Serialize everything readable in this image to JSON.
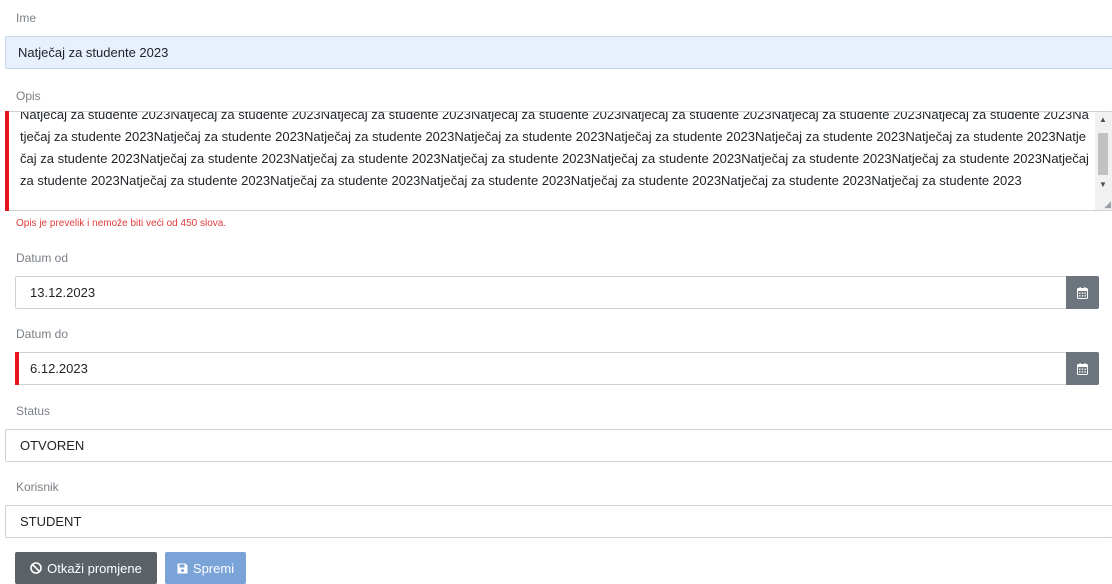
{
  "form": {
    "name": {
      "label": "Ime",
      "value": "Natječaj za studente 2023"
    },
    "description": {
      "label": "Opis",
      "value": "Natječaj za studente 2023Natječaj za studente 2023Natječaj za studente 2023Natječaj za studente 2023Natječaj za studente 2023Natječaj za studente 2023Natječaj za studente 2023Natječaj za studente 2023Natječaj za studente 2023Natječaj za studente 2023Natječaj za studente 2023Natječaj za studente 2023Natječaj za studente 2023Natječaj za studente 2023Natječaj za studente 2023Natječaj za studente 2023Natječaj za studente 2023Natječaj za studente 2023Natječaj za studente 2023Natječaj za studente 2023Natječaj za studente 2023Natječaj za studente 2023Natječaj za studente 2023Natječaj za studente 2023Natječaj za studente 2023Natječaj za studente 2023Natječaj za studente 2023Natječaj za studente 2023",
      "error": "Opis je prevelik i nemože biti veći od 450 slova."
    },
    "date_from": {
      "label": "Datum od",
      "value": "13.12.2023",
      "picker_icon": "calendar-icon"
    },
    "date_to": {
      "label": "Datum do",
      "value": "6.12.2023",
      "picker_icon": "calendar-icon"
    },
    "status": {
      "label": "Status",
      "value": "OTVOREN"
    },
    "user": {
      "label": "Korisnik",
      "value": "STUDENT"
    }
  },
  "actions": {
    "cancel_label": "Otkaži promjene",
    "cancel_icon": "ban-icon",
    "save_label": "Spremi",
    "save_icon": "floppy-disk-icon"
  },
  "colors": {
    "invalid": "#e8141b",
    "error_text": "#e23b3b",
    "cancel_button": "#5a6268",
    "save_button": "#7aa3d8",
    "autofill_background": "#e8f0fe"
  }
}
